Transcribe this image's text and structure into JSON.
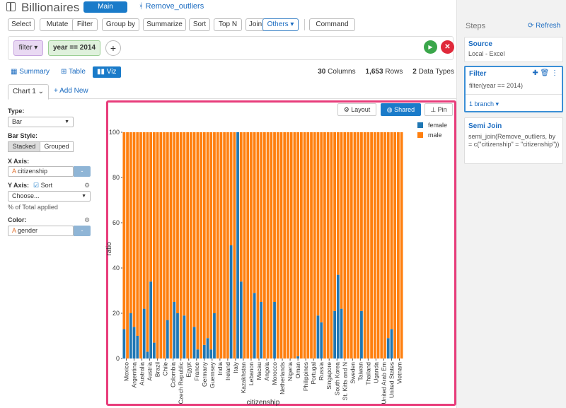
{
  "app": {
    "title": "Billionaires",
    "main_tab": "Main",
    "branch_tab": "Remove_outliers"
  },
  "toolbar": {
    "buttons": [
      "Select",
      "Mutate",
      "Filter",
      "Group by",
      "Summarize",
      "Sort",
      "Top N",
      "Join",
      "Others ▾",
      "Command"
    ]
  },
  "filterbar": {
    "chip_filter": "filter ▾",
    "chip_condition": "year == 2014"
  },
  "view_tabs": {
    "summary": "Summary",
    "table": "Table",
    "viz": "Viz"
  },
  "stats": {
    "columns": "30",
    "columns_label": "Columns",
    "rows": "1,653",
    "rows_label": "Rows",
    "types": "2",
    "types_label": "Data Types"
  },
  "chart_tabs": {
    "active": "Chart 1 ⌄",
    "add": "+ Add New"
  },
  "config": {
    "type_label": "Type:",
    "type_value": "Bar",
    "bar_style_label": "Bar Style:",
    "stacked": "Stacked",
    "grouped": "Grouped",
    "x_label": "X Axis:",
    "x_value": "citizenship",
    "y_label": "Y Axis:",
    "sort_label": "Sort",
    "y_value": "Choose...",
    "y_note": "% of Total applied",
    "color_label": "Color:",
    "color_value": "gender"
  },
  "chart_buttons": {
    "layout": "Layout",
    "shared": "Shared",
    "pin": "Pin"
  },
  "chart_data": {
    "type": "bar",
    "stacked": true,
    "xlabel": "citizenship",
    "ylabel": "ratio",
    "ylim": [
      0,
      100
    ],
    "yticks": [
      0,
      20,
      40,
      60,
      80,
      100
    ],
    "grid": false,
    "legend_position": "top-right",
    "category_labels": [
      "Mexico",
      "Argentina",
      "Australia",
      "Austria",
      "Brazil",
      "Chile",
      "Colombia",
      "Czech Republic",
      "Egypt",
      "France",
      "Germany",
      "Guernsey",
      "India",
      "Ireland",
      "Italy",
      "Kazakhstan",
      "Lebanon",
      "Macau",
      "Angola",
      "Morocco",
      "Netherlands",
      "Nigeria",
      "Oman",
      "Philippines",
      "Portugal",
      "Russia",
      "Singapore",
      "South Korea",
      "St. Kitts and N",
      "Sweden",
      "Taiwan",
      "Thailand",
      "Uganda",
      "United Arab Em",
      "United States",
      "Vietnam"
    ],
    "series": [
      {
        "name": "female",
        "color": "#1f77b4",
        "values": [
          13,
          0,
          20,
          14,
          10,
          0,
          22,
          3,
          34,
          7,
          0,
          0,
          0,
          17,
          0,
          25,
          20,
          0,
          19,
          0,
          0,
          14,
          4,
          0,
          6,
          9,
          4,
          20,
          0,
          0,
          0,
          0,
          50,
          0,
          100,
          34,
          0,
          0,
          0,
          29,
          0,
          25,
          0,
          0,
          0,
          25,
          0,
          0,
          0,
          0,
          0,
          0,
          1,
          0,
          0,
          0,
          0,
          0,
          19,
          16,
          0,
          0,
          0,
          21,
          37,
          22,
          0,
          0,
          0,
          0,
          0,
          21,
          0,
          0,
          0,
          0,
          0,
          0,
          0,
          9,
          13,
          0,
          0,
          0
        ]
      },
      {
        "name": "male",
        "color": "#ff7f0e",
        "values": [
          87,
          100,
          80,
          86,
          90,
          100,
          78,
          97,
          66,
          93,
          100,
          100,
          100,
          83,
          100,
          75,
          80,
          100,
          81,
          100,
          100,
          86,
          96,
          100,
          94,
          91,
          96,
          80,
          100,
          100,
          100,
          100,
          50,
          100,
          0,
          66,
          100,
          100,
          100,
          71,
          100,
          75,
          100,
          100,
          100,
          75,
          100,
          100,
          100,
          100,
          100,
          100,
          99,
          100,
          100,
          100,
          100,
          100,
          81,
          84,
          100,
          100,
          100,
          79,
          63,
          78,
          100,
          100,
          100,
          100,
          100,
          79,
          100,
          100,
          100,
          100,
          100,
          100,
          100,
          91,
          87,
          100,
          100,
          100
        ]
      }
    ]
  },
  "steps": {
    "title": "Steps",
    "refresh": "Refresh",
    "source_title": "Source",
    "source_sub": "Local - Excel",
    "filter_title": "Filter",
    "filter_sub": "filter(year == 2014)",
    "filter_branch": "1 branch ▾",
    "semijoin_title": "Semi Join",
    "semijoin_sub": "semi_join(Remove_outliers, by = c(\"citizenship\" = \"citizenship\"))"
  }
}
